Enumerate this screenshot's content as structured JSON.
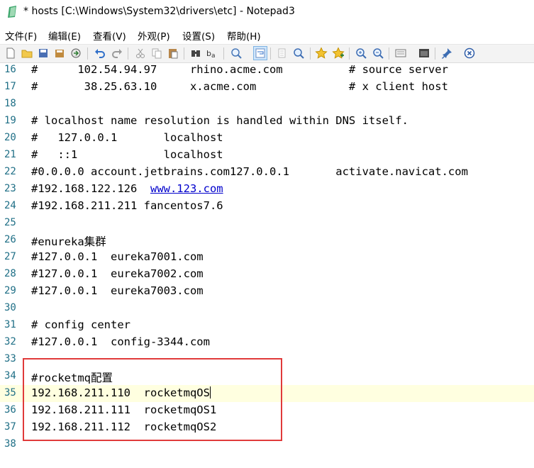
{
  "window": {
    "title": "* hosts [C:\\Windows\\System32\\drivers\\etc] - Notepad3"
  },
  "menu": [
    "文件(F)",
    "编辑(E)",
    "查看(V)",
    "外观(P)",
    "设置(S)",
    "帮助(H)"
  ],
  "toolbar": {
    "icons": [
      "new-file-icon",
      "open-folder-icon",
      "save-icon",
      "save-as-icon",
      "browse-icon",
      "undo-icon",
      "redo-icon",
      "cut-icon",
      "copy-icon",
      "paste-icon",
      "find-icon",
      "replace-icon",
      "zoom-find-icon",
      "word-wrap-icon",
      "select-icon",
      "search-icon",
      "bookmark-star-icon",
      "bookmark-add-icon",
      "zoom-in-icon",
      "zoom-out-icon",
      "settings-icon",
      "view-icon",
      "pin-icon",
      "close-icon"
    ]
  },
  "editor": {
    "current_line": 35,
    "lines": [
      {
        "n": "16",
        "text": "#      102.54.94.97     rhino.acme.com          # source server"
      },
      {
        "n": "17",
        "text": "#       38.25.63.10     x.acme.com              # x client host"
      },
      {
        "n": "18",
        "text": ""
      },
      {
        "n": "19",
        "text": "# localhost name resolution is handled within DNS itself."
      },
      {
        "n": "20",
        "text": "#   127.0.0.1       localhost"
      },
      {
        "n": "21",
        "text": "#   ::1             localhost"
      },
      {
        "n": "22",
        "text": "#0.0.0.0 account.jetbrains.com127.0.0.1       activate.navicat.com"
      },
      {
        "n": "23",
        "text": "#192.168.122.126  ",
        "link": "www.123.com"
      },
      {
        "n": "24",
        "text": "#192.168.211.211 fancentos7.6"
      },
      {
        "n": "25",
        "text": ""
      },
      {
        "n": "26",
        "text": "#enureka集群"
      },
      {
        "n": "27",
        "text": "#127.0.0.1  eureka7001.com"
      },
      {
        "n": "28",
        "text": "#127.0.0.1  eureka7002.com"
      },
      {
        "n": "29",
        "text": "#127.0.0.1  eureka7003.com"
      },
      {
        "n": "30",
        "text": ""
      },
      {
        "n": "31",
        "text": "# config center"
      },
      {
        "n": "32",
        "text": "#127.0.0.1  config-3344.com"
      },
      {
        "n": "33",
        "text": ""
      },
      {
        "n": "34",
        "text": "#rocketmq配置"
      },
      {
        "n": "35",
        "text": "192.168.211.110  rocketmqOS"
      },
      {
        "n": "36",
        "text": "192.168.211.111  rocketmqOS1"
      },
      {
        "n": "37",
        "text": "192.168.211.112  rocketmqOS2"
      },
      {
        "n": "38",
        "text": ""
      }
    ]
  },
  "colors": {
    "line_number": "#1f6f86",
    "current_line_bg": "#ffffe0",
    "link": "#0000cc",
    "annotation_box": "#e03a3a"
  }
}
